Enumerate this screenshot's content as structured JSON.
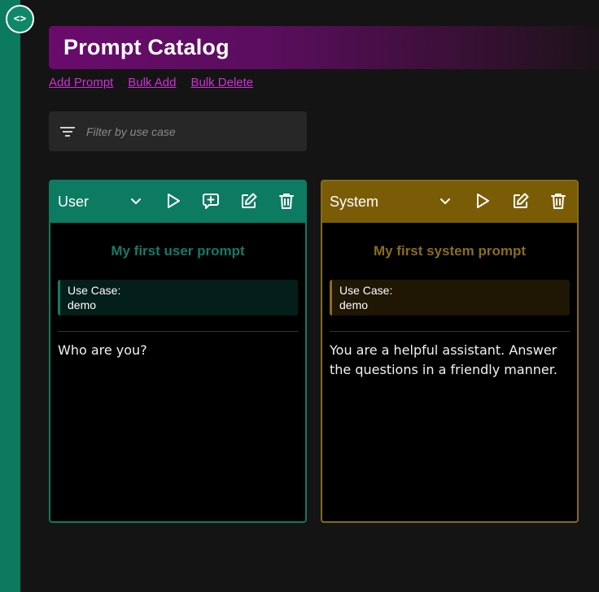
{
  "sidebar": {
    "toggle_label": "<>"
  },
  "header": {
    "title": "Prompt Catalog"
  },
  "actions": {
    "add": "Add Prompt",
    "bulk_add": "Bulk Add",
    "bulk_delete": "Bulk Delete"
  },
  "filter": {
    "placeholder": "Filter by use case",
    "value": ""
  },
  "cards": [
    {
      "type": "User",
      "title": "My first user prompt",
      "use_case_label": "Use Case:",
      "use_case": "demo",
      "body": "Who are you?",
      "accent": "#0d7b62"
    },
    {
      "type": "System",
      "title": "My first system prompt",
      "use_case_label": "Use Case:",
      "use_case": "demo",
      "body": "You are a helpful assistant. Answer the questions in a friendly manner.",
      "accent": "#7b5c06"
    }
  ],
  "icons": [
    "chevron-down-icon",
    "play-icon",
    "add-comment-icon",
    "edit-icon",
    "trash-icon",
    "filter-icon"
  ]
}
